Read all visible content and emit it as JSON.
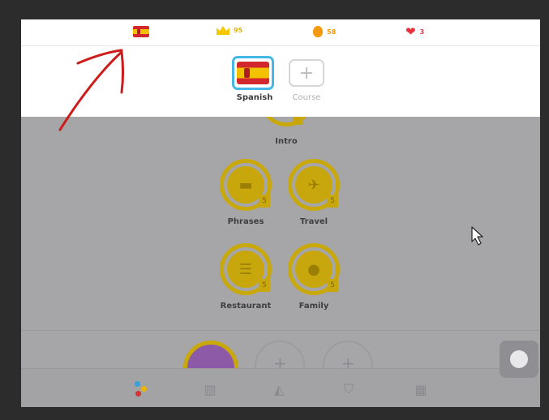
{
  "topbar": {
    "crowns": "95",
    "streak": "58",
    "hearts": "3"
  },
  "courses": {
    "selected_label": "Spanish",
    "add_symbol": "+",
    "add_label": "Course"
  },
  "skills": {
    "intro": "Intro",
    "phrases": "Phrases",
    "travel": "Travel",
    "restaurant": "Restaurant",
    "family": "Family",
    "crown_level": "5"
  },
  "next_row": {
    "plus": "+"
  },
  "colors": {
    "accent_blue": "#46b8e8",
    "gold": "#c9a80a",
    "heart_red": "#e8333f",
    "streak_orange": "#f59a0c",
    "annotation_red": "#cc1c1c"
  }
}
